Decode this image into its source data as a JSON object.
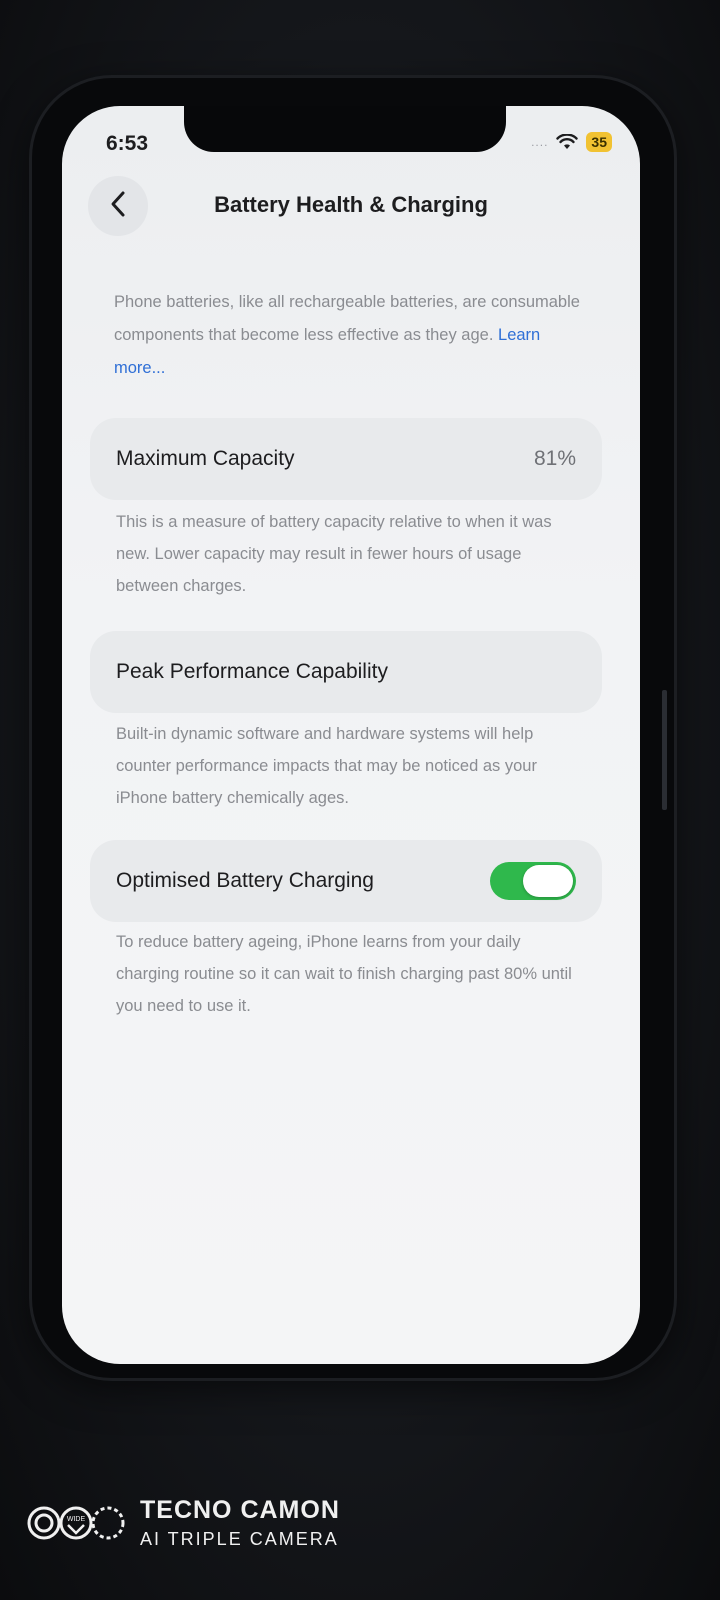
{
  "status_bar": {
    "time": "6:53",
    "signal": "....",
    "battery": "35",
    "battery_color": "#f1c232"
  },
  "header": {
    "title": "Battery Health & Charging",
    "back_icon": "chevron-left-icon"
  },
  "intro": {
    "text": "Phone batteries, like all rechargeable batteries, are consumable components that become less effective as they age.",
    "link": "Learn more..."
  },
  "maximum_capacity": {
    "label": "Maximum Capacity",
    "value": "81%",
    "description": "This is a measure of battery capacity relative to when it was new. Lower capacity may result in fewer hours of usage between charges."
  },
  "peak_performance": {
    "label": "Peak Performance Capability",
    "description": "Built-in dynamic software and hardware systems will help counter performance impacts that may be noticed as your iPhone battery chemically ages."
  },
  "optimised_charging": {
    "label": "Optimised Battery Charging",
    "enabled": true,
    "toggle_color": "#2fb84c",
    "description": "To reduce battery ageing, iPhone learns from your daily charging routine so it can wait to finish charging past 80% until you need to use it."
  },
  "watermark": {
    "logo_text": "WIDE",
    "brand": "TECNO CAMON",
    "subtitle": "AI TRIPLE CAMERA"
  }
}
